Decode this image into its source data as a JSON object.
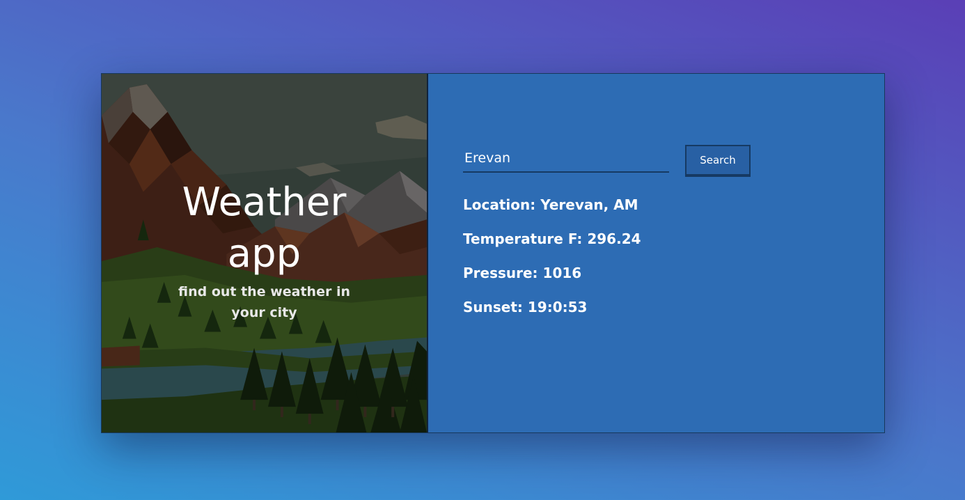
{
  "hero": {
    "title": "Weather app",
    "subtitle": "find out the weather in your city"
  },
  "search": {
    "value": "Erevan",
    "button_label": "Search"
  },
  "results": {
    "location": "Location: Yerevan, AM",
    "temperature": "Temperature F: 296.24",
    "pressure": "Pressure: 1016",
    "sunset": "Sunset: 19:0:53"
  },
  "colors": {
    "panel": "#2d6cb4",
    "accent_border": "#163a63",
    "button": "#2860a4"
  }
}
